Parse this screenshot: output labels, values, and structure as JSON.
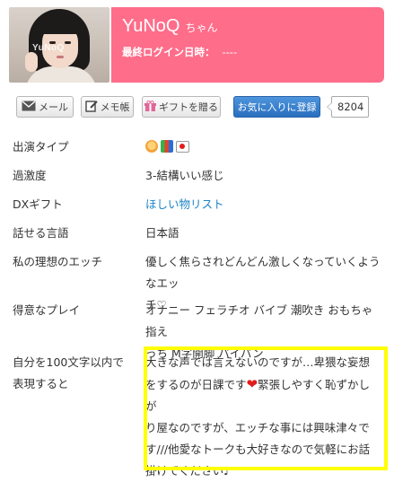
{
  "header": {
    "name": "YuNoQ",
    "name_suffix": "ちゃん",
    "last_login_label": "最終ログイン日時：",
    "last_login_value": "----",
    "photo_watermark": "YuNoQ",
    "banner_color": "#fe6d8a"
  },
  "toolbar": {
    "mail_label": "メール",
    "mail_icon": "envelope-icon",
    "memo_label": "メモ帳",
    "memo_icon": "note-edit-icon",
    "gift_label": "ギフトを贈る",
    "gift_icon": "gift-icon",
    "favorite_label": "お気に入りに登録",
    "favorite_count": "8204",
    "favorite_color": "#2a6fc0"
  },
  "profile": {
    "rows": [
      {
        "label": "出演タイプ",
        "value": "",
        "icons": [
          "face-emoji-icon",
          "three-color-emoji-icon",
          "flag-japan-icon"
        ]
      },
      {
        "label": "過激度",
        "value": "3-結構いい感じ"
      },
      {
        "label": "DXギフト",
        "value": "ほしい物リスト"
      },
      {
        "label": "話せる言語",
        "value": "日本語"
      },
      {
        "label": "私の理想のエッチ",
        "value_lines": [
          "優しく焦らされどんどん激しくなっていくようなエッ",
          "チ♡"
        ]
      },
      {
        "label": "得意なプレイ",
        "value_lines": [
          "オナニー フェラチオ バイブ 潮吹き おもちゃ 指え",
          "っち M字開脚 パイパン"
        ]
      },
      {
        "label_lines": [
          "自分を100文字以内で",
          "表現すると"
        ],
        "value_lines": [
          "大きな声では言えないのですが…卑猥な妄想",
          "をするのが日課です",
          "緊張しやすく恥ずかしが",
          "り屋なのですが、エッチな事には興味津々で",
          "す///他愛なトークも大好きなので気軽にお話",
          "掛けてください♪"
        ]
      }
    ],
    "heart_icon": "heart-icon",
    "highlight_color": "#ffff00",
    "link_color": "#1b84c8"
  }
}
